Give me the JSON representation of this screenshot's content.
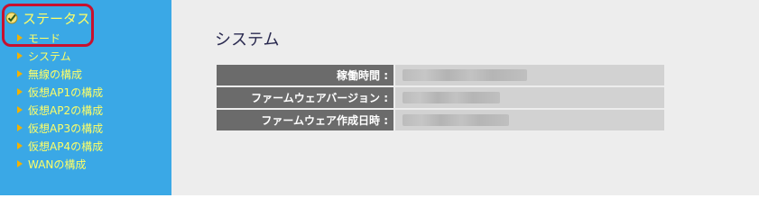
{
  "sidebar": {
    "header_label": "ステータス",
    "items": [
      {
        "label": "モード"
      },
      {
        "label": "システム"
      },
      {
        "label": "無線の構成"
      },
      {
        "label": "仮想AP1の構成"
      },
      {
        "label": "仮想AP2の構成"
      },
      {
        "label": "仮想AP3の構成"
      },
      {
        "label": "仮想AP4の構成"
      },
      {
        "label": "WANの構成"
      }
    ]
  },
  "main": {
    "title": "システム",
    "rows": [
      {
        "label": "稼働時間 :",
        "value": ""
      },
      {
        "label": "ファームウェアバージョン :",
        "value": ""
      },
      {
        "label": "ファームウェア作成日時 :",
        "value": ""
      }
    ]
  },
  "colors": {
    "sidebar_bg": "#3aa8e6",
    "nav_text": "#ffff66",
    "highlight_ring": "#c8102e",
    "table_header_bg": "#6b6b6b",
    "table_value_bg": "#d2d2d2"
  },
  "icons": {
    "status": "checkmark-icon",
    "nav_bullet": "triangle-right-icon"
  }
}
